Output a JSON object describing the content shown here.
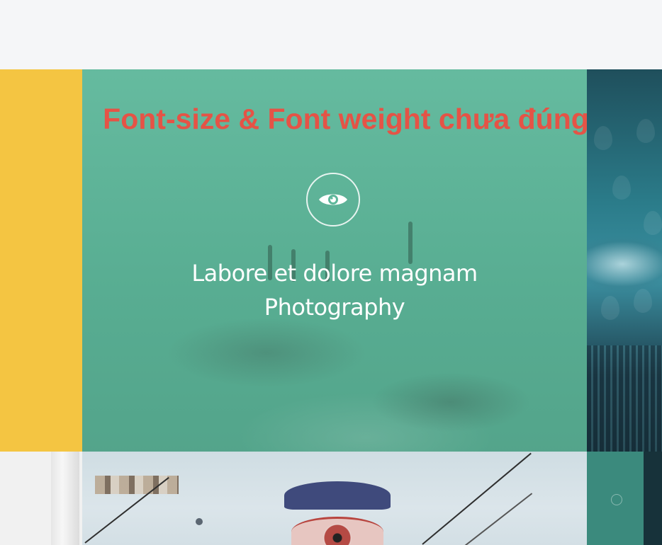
{
  "annotation": {
    "text": "Font-size & Font weight chưa đúng",
    "color": "#e55346"
  },
  "portfolio": {
    "featured": {
      "title": "Labore et dolore magnam",
      "category": "Photography",
      "overlay_color": "#5db79a",
      "action_icon": "eye-icon"
    },
    "tiles": [
      {
        "name": "yellow",
        "color": "#f4c542"
      },
      {
        "name": "rain-city",
        "color": "#2b7c8a"
      },
      {
        "name": "white-paper",
        "color": "#f1f1f1"
      },
      {
        "name": "eye-art",
        "color": "#d3dfe5"
      },
      {
        "name": "teal",
        "color": "#3b8a7d"
      }
    ]
  }
}
